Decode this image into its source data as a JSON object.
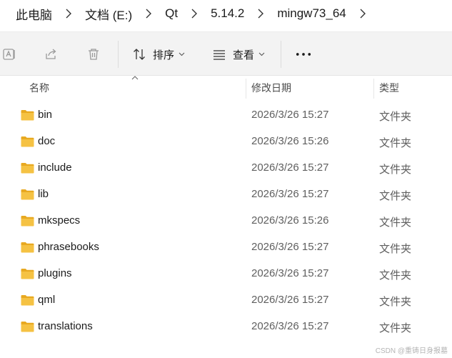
{
  "breadcrumb": [
    "此电脑",
    "文档 (E:)",
    "Qt",
    "5.14.2",
    "mingw73_64"
  ],
  "toolbar": {
    "ai_icon": "ai-rename-icon",
    "share_icon": "share-icon",
    "delete_icon": "trash-icon",
    "sort_label": "排序",
    "view_label": "查看",
    "more_label": "···"
  },
  "columns": {
    "name": "名称",
    "modified": "修改日期",
    "type": "类型"
  },
  "files": [
    {
      "name": "bin",
      "modified": "2026/3/26 15:27",
      "type": "文件夹"
    },
    {
      "name": "doc",
      "modified": "2026/3/26 15:26",
      "type": "文件夹"
    },
    {
      "name": "include",
      "modified": "2026/3/26 15:27",
      "type": "文件夹"
    },
    {
      "name": "lib",
      "modified": "2026/3/26 15:27",
      "type": "文件夹"
    },
    {
      "name": "mkspecs",
      "modified": "2026/3/26 15:26",
      "type": "文件夹"
    },
    {
      "name": "phrasebooks",
      "modified": "2026/3/26 15:27",
      "type": "文件夹"
    },
    {
      "name": "plugins",
      "modified": "2026/3/26 15:27",
      "type": "文件夹"
    },
    {
      "name": "qml",
      "modified": "2026/3/26 15:27",
      "type": "文件夹"
    },
    {
      "name": "translations",
      "modified": "2026/3/26 15:27",
      "type": "文件夹"
    }
  ],
  "watermark": "CSDN @重铸日身报墓",
  "colors": {
    "folder": "#f5c243",
    "folder_dark": "#e8a921",
    "toolbar_bg": "#f3f3f3",
    "text_secondary": "#5f5f5f"
  }
}
